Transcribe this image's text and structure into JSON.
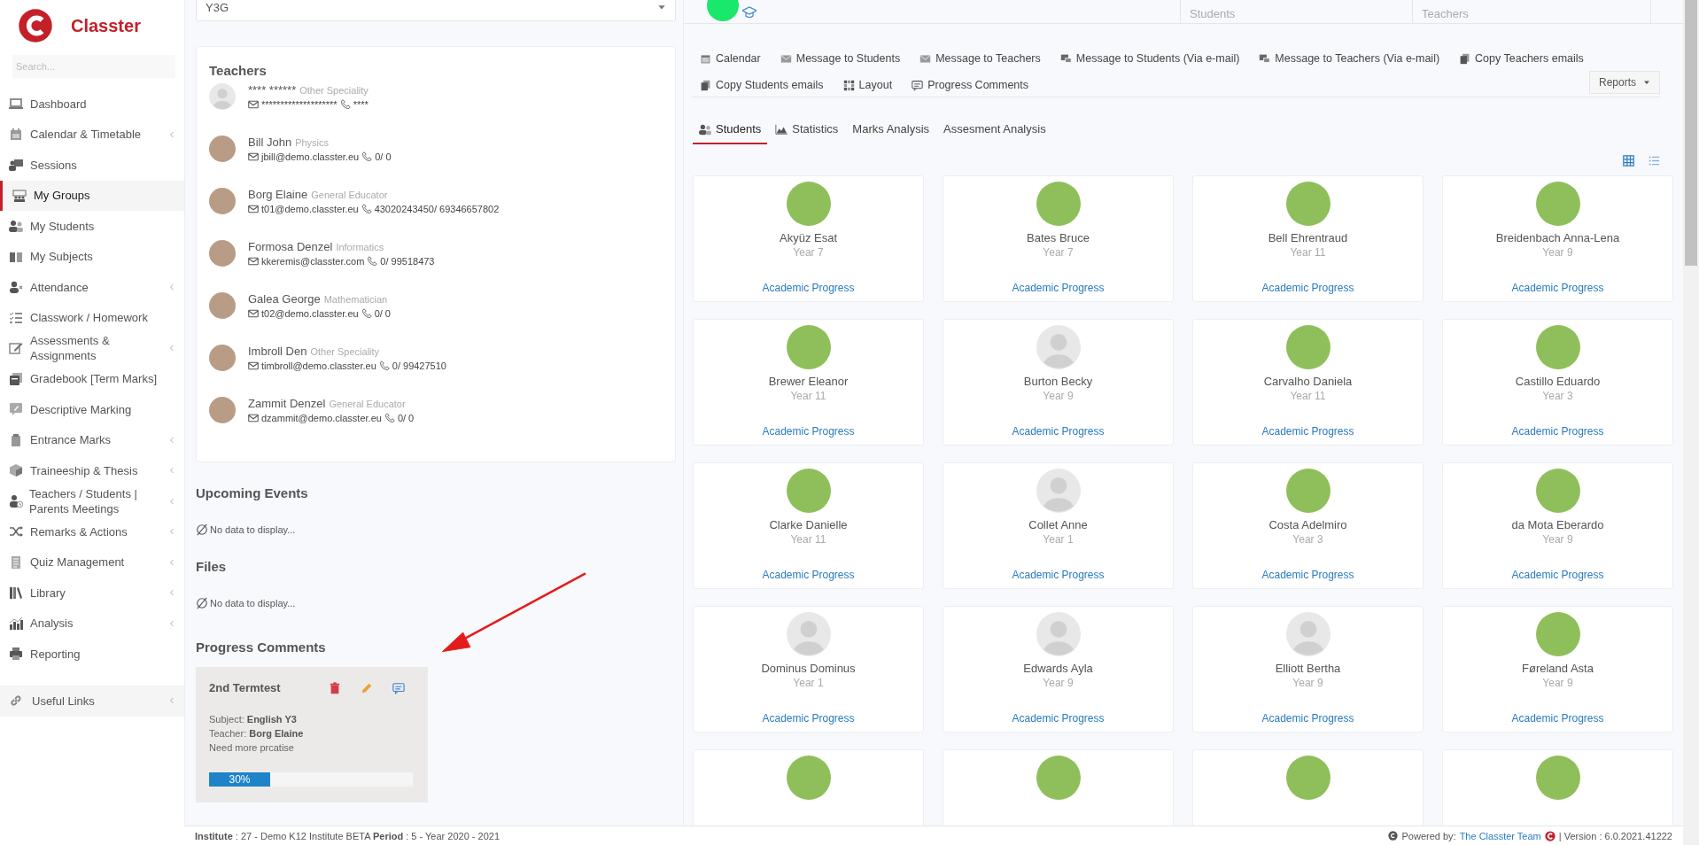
{
  "sidebar": {
    "logo_text": "Classter",
    "search": {
      "placeholder": "Search..."
    },
    "items": [
      {
        "label": "Dashboard",
        "selected": false,
        "has_submenu": false
      },
      {
        "label": "Calendar & Timetable",
        "selected": false,
        "has_submenu": true
      },
      {
        "label": "Sessions",
        "selected": false,
        "has_submenu": false
      },
      {
        "label": "My Groups",
        "selected": true,
        "has_submenu": false
      },
      {
        "label": "My Students",
        "selected": false,
        "has_submenu": false
      },
      {
        "label": "My Subjects",
        "selected": false,
        "has_submenu": false
      },
      {
        "label": "Attendance",
        "selected": false,
        "has_submenu": true
      },
      {
        "label": "Classwork / Homework",
        "selected": false,
        "has_submenu": false
      },
      {
        "label": "Assessments & Assignments",
        "selected": false,
        "has_submenu": true
      },
      {
        "label": "Gradebook [Term Marks]",
        "selected": false,
        "has_submenu": false
      },
      {
        "label": "Descriptive Marking",
        "selected": false,
        "has_submenu": false
      },
      {
        "label": "Entrance Marks",
        "selected": false,
        "has_submenu": true
      },
      {
        "label": "Traineeship & Thesis",
        "selected": false,
        "has_submenu": true
      },
      {
        "label": "Teachers / Students | Parents Meetings",
        "selected": false,
        "has_submenu": true
      },
      {
        "label": "Remarks & Actions",
        "selected": false,
        "has_submenu": true
      },
      {
        "label": "Quiz Management",
        "selected": false,
        "has_submenu": true
      },
      {
        "label": "Library",
        "selected": false,
        "has_submenu": true
      },
      {
        "label": "Analysis",
        "selected": false,
        "has_submenu": true
      },
      {
        "label": "Reporting",
        "selected": false,
        "has_submenu": false
      }
    ],
    "footer_item": {
      "label": "Useful Links",
      "has_submenu": true
    }
  },
  "group_select": {
    "value": "Y3G"
  },
  "teachers": {
    "title": "Teachers",
    "items": [
      {
        "name": "**** ******",
        "speciality": "Other Speciality",
        "email": "********************",
        "phone": "****",
        "photo": false
      },
      {
        "name": "Bill John",
        "speciality": "Physics",
        "email": "jbill@demo.classter.eu",
        "phone": "0/ 0",
        "photo": true
      },
      {
        "name": "Borg Elaine",
        "speciality": "General Educator",
        "email": "t01@demo.classter.eu",
        "phone": "43020243450/ 69346657802",
        "photo": true
      },
      {
        "name": "Formosa Denzel",
        "speciality": "Informatics",
        "email": "kkeremis@classter.com",
        "phone": "0/ 99518473",
        "photo": true
      },
      {
        "name": "Galea George",
        "speciality": "Mathematician",
        "email": "t02@demo.classter.eu",
        "phone": "0/ 0",
        "photo": true
      },
      {
        "name": "Imbroll Den",
        "speciality": "Other Speciality",
        "email": "timbroll@demo.classter.eu",
        "phone": "0/ 99427510",
        "photo": true
      },
      {
        "name": "Zammit Denzel",
        "speciality": "General Educator",
        "email": "dzammit@demo.classter.eu",
        "phone": "0/ 0",
        "photo": true
      }
    ]
  },
  "upcoming_events": {
    "title": "Upcoming Events",
    "empty_text": "No data to display..."
  },
  "files": {
    "title": "Files",
    "empty_text": "No data to display..."
  },
  "progress_comments": {
    "title": "Progress Comments",
    "items": [
      {
        "title": "2nd Termtest",
        "subject_label": "Subject:",
        "subject": "English Y3",
        "teacher_label": "Teacher:",
        "teacher": "Borg Elaine",
        "comment": "Need more prcatise",
        "level": 0.3,
        "reading": "30%"
      }
    ]
  },
  "header": {
    "stats": [
      {
        "label": "Students"
      },
      {
        "label": "Teachers"
      }
    ]
  },
  "toolbar": {
    "actions": [
      {
        "label": "Calendar"
      },
      {
        "label": "Message to Students"
      },
      {
        "label": "Message to Teachers"
      },
      {
        "label": "Message to Students (Via e-mail)"
      },
      {
        "label": "Message to Teachers (Via e-mail)"
      },
      {
        "label": "Copy Teachers emails"
      },
      {
        "label": "Copy Students emails"
      },
      {
        "label": "Layout"
      },
      {
        "label": "Progress Comments"
      }
    ],
    "reports": "Reports"
  },
  "tabs": [
    {
      "label": "Students",
      "selected": true
    },
    {
      "label": "Statistics",
      "selected": false
    },
    {
      "label": "Marks Analysis",
      "selected": false
    },
    {
      "label": "Assesment Analysis",
      "selected": false
    }
  ],
  "view_modes": [
    {
      "selected": true
    },
    {
      "selected": false
    }
  ],
  "students": [
    {
      "name": "Akyüz Esat",
      "year": "Year 7",
      "link": "Academic Progress",
      "photo": true
    },
    {
      "name": "Bates Bruce",
      "year": "Year 7",
      "link": "Academic Progress",
      "photo": true
    },
    {
      "name": "Bell Ehrentraud",
      "year": "Year 11",
      "link": "Academic Progress",
      "photo": true
    },
    {
      "name": "Breidenbach Anna-Lena",
      "year": "Year 9",
      "link": "Academic Progress",
      "photo": true
    },
    {
      "name": "Brewer Eleanor",
      "year": "Year 11",
      "link": "Academic Progress",
      "photo": true
    },
    {
      "name": "Burton Becky",
      "year": "Year 9",
      "link": "Academic Progress",
      "photo": false
    },
    {
      "name": "Carvalho Daniela",
      "year": "Year 11",
      "link": "Academic Progress",
      "photo": true
    },
    {
      "name": "Castillo Eduardo",
      "year": "Year 3",
      "link": "Academic Progress",
      "photo": true
    },
    {
      "name": "Clarke Danielle",
      "year": "Year 11",
      "link": "Academic Progress",
      "photo": true
    },
    {
      "name": "Collet Anne",
      "year": "Year 1",
      "link": "Academic Progress",
      "photo": false
    },
    {
      "name": "Costa Adelmiro",
      "year": "Year 3",
      "link": "Academic Progress",
      "photo": true
    },
    {
      "name": "da Mota Eberardo",
      "year": "Year 9",
      "link": "Academic Progress",
      "photo": true
    },
    {
      "name": "Dominus Dominus",
      "year": "Year 1",
      "link": "Academic Progress",
      "photo": false
    },
    {
      "name": "Edwards Ayla",
      "year": "Year 9",
      "link": "Academic Progress",
      "photo": false
    },
    {
      "name": "Elliott Bertha",
      "year": "Year 9",
      "link": "Academic Progress",
      "photo": false
    },
    {
      "name": "Føreland Asta",
      "year": "Year 9",
      "link": "Academic Progress",
      "photo": true
    },
    {
      "photo": true
    },
    {
      "photo": true
    },
    {
      "photo": true
    },
    {
      "photo": true
    }
  ],
  "status_bar": {
    "left": "**Institute** : 27 - Demo K12 Institute BETA **Period** : 5 - Year 2020 - 2021",
    "powered_by": "Powered by:",
    "team_link": "The Classter Team",
    "version": "| Version : 6.0.2021.41222"
  }
}
